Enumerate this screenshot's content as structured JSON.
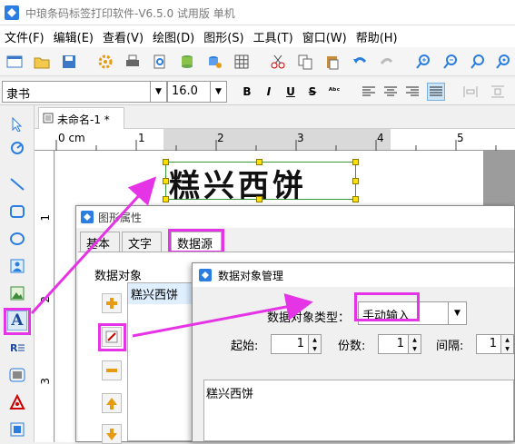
{
  "window": {
    "title": "中琅条码标签打印软件-V6.5.0 试用版 单机"
  },
  "menu": [
    "文件(F)",
    "编辑(E)",
    "查看(V)",
    "绘图(D)",
    "图形(S)",
    "工具(T)",
    "窗口(W)",
    "帮助(H)"
  ],
  "toolbar": {
    "font_name": "隶书",
    "font_size": "16.0",
    "bold": "B",
    "italic": "I",
    "underline": "U",
    "strike": "S",
    "format": "ᴬᵇᶜ"
  },
  "document": {
    "tab_label": "未命名-1 *",
    "ruler_unit": "0 cm",
    "ruler_marks": [
      "1",
      "2",
      "3",
      "4",
      "5"
    ],
    "vruler_marks": [
      "1",
      "2",
      "3"
    ],
    "label_text": "糕兴西饼"
  },
  "props_dialog": {
    "title": "图形属性",
    "tabs": [
      "基本",
      "文字",
      "数据源"
    ],
    "group_label": "数据对象",
    "list_items": [
      "糕兴西饼"
    ]
  },
  "dm_dialog": {
    "title": "数据对象管理",
    "type_label": "数据对象类型：",
    "type_value": "手动输入",
    "start_label": "起始:",
    "start_value": "1",
    "count_label": "份数:",
    "count_value": "1",
    "interval_label": "间隔:",
    "interval_value": "1",
    "content": "糕兴西饼"
  },
  "colors": {
    "highlight": "#e534e5",
    "handle": "#ffe000",
    "accent": "#1a73e8"
  }
}
